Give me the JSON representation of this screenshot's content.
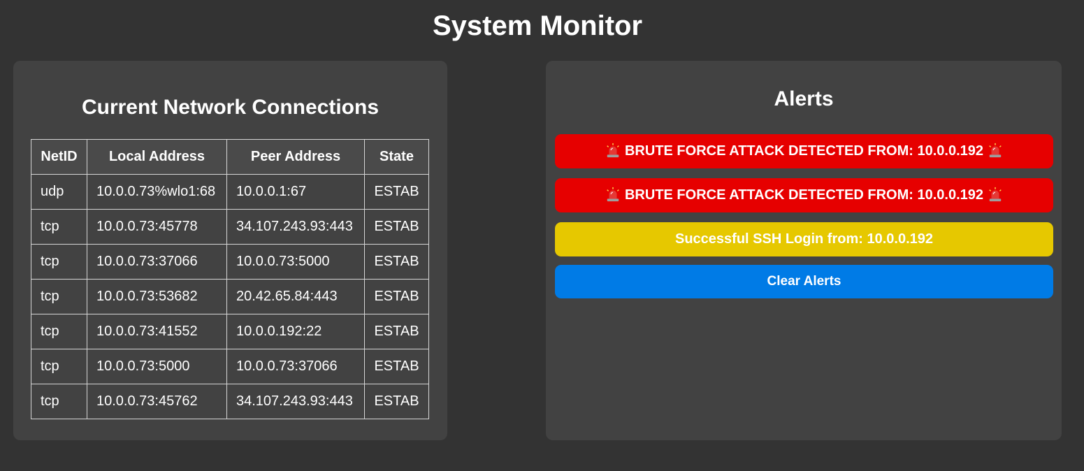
{
  "page": {
    "title": "System Monitor"
  },
  "connections": {
    "heading": "Current Network Connections",
    "headers": [
      "NetID",
      "Local Address",
      "Peer Address",
      "State"
    ],
    "rows": [
      [
        "udp",
        "10.0.0.73%wlo1:68",
        "10.0.0.1:67",
        "ESTAB"
      ],
      [
        "tcp",
        "10.0.0.73:45778",
        "34.107.243.93:443",
        "ESTAB"
      ],
      [
        "tcp",
        "10.0.0.73:37066",
        "10.0.0.73:5000",
        "ESTAB"
      ],
      [
        "tcp",
        "10.0.0.73:53682",
        "20.42.65.84:443",
        "ESTAB"
      ],
      [
        "tcp",
        "10.0.0.73:41552",
        "10.0.0.192:22",
        "ESTAB"
      ],
      [
        "tcp",
        "10.0.0.73:5000",
        "10.0.0.73:37066",
        "ESTAB"
      ],
      [
        "tcp",
        "10.0.0.73:45762",
        "34.107.243.93:443",
        "ESTAB"
      ]
    ]
  },
  "alerts": {
    "heading": "Alerts",
    "items": [
      {
        "text": "BRUTE FORCE ATTACK DETECTED FROM: 10.0.0.192",
        "level": "danger",
        "icon": "siren-icon",
        "color": "#e60000"
      },
      {
        "text": "BRUTE FORCE ATTACK DETECTED FROM: 10.0.0.192",
        "level": "danger",
        "icon": "siren-icon",
        "color": "#e60000"
      },
      {
        "text": "Successful SSH Login from: 10.0.0.192",
        "level": "success",
        "icon": "",
        "color": "#e6c800"
      }
    ],
    "clear_label": "Clear Alerts",
    "clear_color": "#007be6"
  }
}
